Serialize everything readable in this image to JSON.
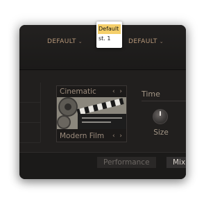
{
  "header": {
    "left_preset": "DEFAULT",
    "right_preset": "DEFAULT"
  },
  "popup": {
    "items": [
      "Default",
      "st. 1"
    ]
  },
  "cell": {
    "top_label": "Cinematic",
    "bottom_label": "Modern Film",
    "arrows": "‹ ›"
  },
  "section": {
    "title": "Time",
    "knob_label": "Size"
  },
  "tabs": {
    "performance": "Performance",
    "mix": "Mix"
  },
  "colors": {
    "accent": "#f5cf6a",
    "label": "#b8997a",
    "panel": "#1e1c1b"
  }
}
